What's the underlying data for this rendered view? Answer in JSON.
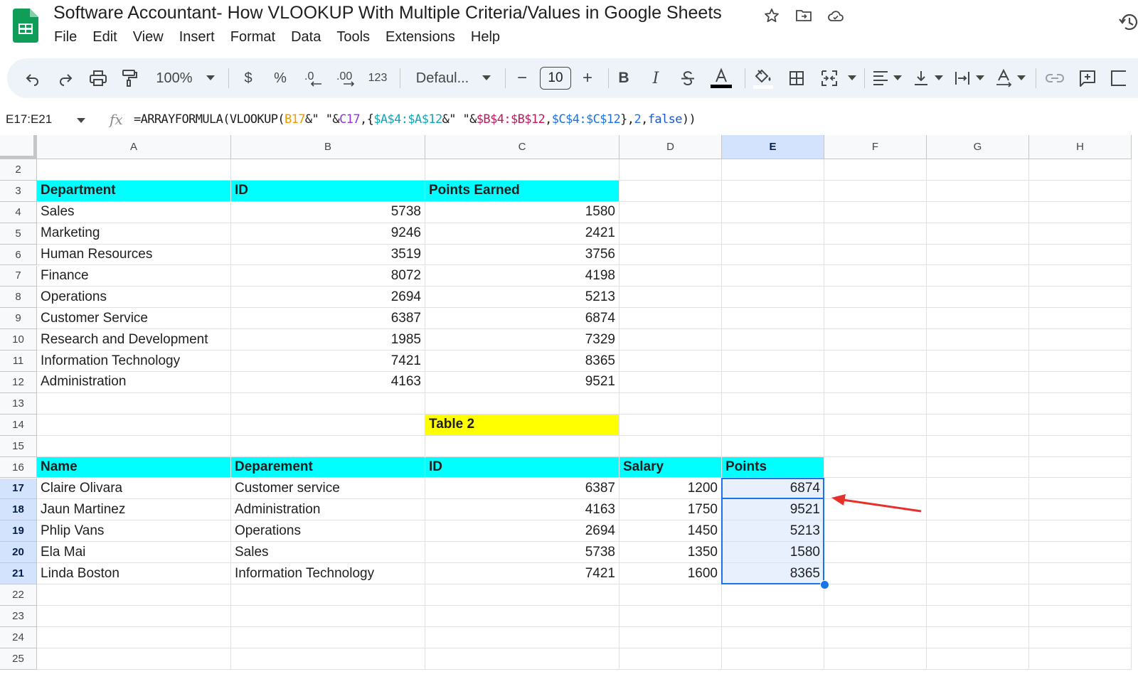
{
  "header": {
    "title": "Software Accountant- How VLOOKUP With Multiple Criteria/Values in Google Sheets",
    "menu": [
      "File",
      "Edit",
      "View",
      "Insert",
      "Format",
      "Data",
      "Tools",
      "Extensions",
      "Help"
    ]
  },
  "toolbar": {
    "zoom": "100%",
    "currency": "$",
    "percent": "%",
    "number_format": "123",
    "font": "Defaul...",
    "font_size": "10",
    "minus": "−",
    "plus": "+",
    "bold": "B",
    "italic": "I"
  },
  "formula_bar": {
    "namebox": "E17:E21",
    "fx": "fx",
    "formula_parts": [
      {
        "text": "=ARRAYFORMULA(VLOOKUP(",
        "color": "#1f1f1f"
      },
      {
        "text": "B17",
        "color": "#f29900"
      },
      {
        "text": "&\" \"&",
        "color": "#1f1f1f"
      },
      {
        "text": "C17",
        "color": "#9334e6"
      },
      {
        "text": ",{",
        "color": "#1f1f1f"
      },
      {
        "text": "$A$4:$A$12",
        "color": "#12a4b8"
      },
      {
        "text": "&\" \"&",
        "color": "#1f1f1f"
      },
      {
        "text": "$B$4:$B$12",
        "color": "#c2185b"
      },
      {
        "text": ",",
        "color": "#1f1f1f"
      },
      {
        "text": "$C$4:$C$12",
        "color": "#1a73e8"
      },
      {
        "text": "},",
        "color": "#1f1f1f"
      },
      {
        "text": "2",
        "color": "#1a73e8"
      },
      {
        "text": ",",
        "color": "#1f1f1f"
      },
      {
        "text": "false",
        "color": "#1a56db"
      },
      {
        "text": "))",
        "color": "#1f1f1f"
      }
    ]
  },
  "sheet": {
    "columns": [
      "A",
      "B",
      "C",
      "D",
      "E",
      "F",
      "G",
      "H"
    ],
    "selected_column": "E",
    "rows": [
      {
        "n": "2",
        "cells": []
      },
      {
        "n": "3",
        "cells": [
          {
            "col": "A",
            "v": "Department",
            "style": "hdr"
          },
          {
            "col": "B",
            "v": "ID",
            "style": "hdr"
          },
          {
            "col": "C",
            "v": "Points Earned",
            "style": "hdr"
          }
        ]
      },
      {
        "n": "4",
        "cells": [
          {
            "col": "A",
            "v": "Sales"
          },
          {
            "col": "B",
            "v": "5738",
            "num": true
          },
          {
            "col": "C",
            "v": "1580",
            "num": true
          }
        ]
      },
      {
        "n": "5",
        "cells": [
          {
            "col": "A",
            "v": "Marketing"
          },
          {
            "col": "B",
            "v": "9246",
            "num": true
          },
          {
            "col": "C",
            "v": "2421",
            "num": true
          }
        ]
      },
      {
        "n": "6",
        "cells": [
          {
            "col": "A",
            "v": "Human Resources"
          },
          {
            "col": "B",
            "v": "3519",
            "num": true
          },
          {
            "col": "C",
            "v": "3756",
            "num": true
          }
        ]
      },
      {
        "n": "7",
        "cells": [
          {
            "col": "A",
            "v": "Finance"
          },
          {
            "col": "B",
            "v": "8072",
            "num": true
          },
          {
            "col": "C",
            "v": "4198",
            "num": true
          }
        ]
      },
      {
        "n": "8",
        "cells": [
          {
            "col": "A",
            "v": "Operations"
          },
          {
            "col": "B",
            "v": "2694",
            "num": true
          },
          {
            "col": "C",
            "v": "5213",
            "num": true
          }
        ]
      },
      {
        "n": "9",
        "cells": [
          {
            "col": "A",
            "v": "Customer Service"
          },
          {
            "col": "B",
            "v": "6387",
            "num": true
          },
          {
            "col": "C",
            "v": "6874",
            "num": true
          }
        ]
      },
      {
        "n": "10",
        "cells": [
          {
            "col": "A",
            "v": "Research and Development"
          },
          {
            "col": "B",
            "v": "1985",
            "num": true
          },
          {
            "col": "C",
            "v": "7329",
            "num": true
          }
        ]
      },
      {
        "n": "11",
        "cells": [
          {
            "col": "A",
            "v": "Information Technology"
          },
          {
            "col": "B",
            "v": "7421",
            "num": true
          },
          {
            "col": "C",
            "v": "8365",
            "num": true
          }
        ]
      },
      {
        "n": "12",
        "cells": [
          {
            "col": "A",
            "v": "Administration"
          },
          {
            "col": "B",
            "v": "4163",
            "num": true
          },
          {
            "col": "C",
            "v": "9521",
            "num": true
          }
        ]
      },
      {
        "n": "13",
        "cells": []
      },
      {
        "n": "14",
        "cells": [
          {
            "col": "C",
            "v": "Table 2",
            "style": "yel"
          }
        ]
      },
      {
        "n": "15",
        "cells": []
      },
      {
        "n": "16",
        "cells": [
          {
            "col": "A",
            "v": "Name",
            "style": "hdr"
          },
          {
            "col": "B",
            "v": "Deparement",
            "style": "hdr"
          },
          {
            "col": "C",
            "v": "ID",
            "style": "hdr"
          },
          {
            "col": "D",
            "v": "Salary",
            "style": "hdr"
          },
          {
            "col": "E",
            "v": "Points",
            "style": "hdr"
          }
        ]
      },
      {
        "n": "17",
        "sel": true,
        "cells": [
          {
            "col": "A",
            "v": "Claire Olivara"
          },
          {
            "col": "B",
            "v": "Customer service"
          },
          {
            "col": "C",
            "v": "6387",
            "num": true
          },
          {
            "col": "D",
            "v": "1200",
            "num": true
          },
          {
            "col": "E",
            "v": "6874",
            "num": true,
            "style": "selr"
          }
        ]
      },
      {
        "n": "18",
        "sel": true,
        "cells": [
          {
            "col": "A",
            "v": "Jaun Martinez"
          },
          {
            "col": "B",
            "v": "Administration"
          },
          {
            "col": "C",
            "v": "4163",
            "num": true
          },
          {
            "col": "D",
            "v": "1750",
            "num": true
          },
          {
            "col": "E",
            "v": "9521",
            "num": true,
            "style": "selr"
          }
        ]
      },
      {
        "n": "19",
        "sel": true,
        "cells": [
          {
            "col": "A",
            "v": "Phlip Vans"
          },
          {
            "col": "B",
            "v": "Operations"
          },
          {
            "col": "C",
            "v": "2694",
            "num": true
          },
          {
            "col": "D",
            "v": "1450",
            "num": true
          },
          {
            "col": "E",
            "v": "5213",
            "num": true,
            "style": "selr"
          }
        ]
      },
      {
        "n": "20",
        "sel": true,
        "cells": [
          {
            "col": "A",
            "v": "Ela Mai"
          },
          {
            "col": "B",
            "v": "Sales"
          },
          {
            "col": "C",
            "v": "5738",
            "num": true
          },
          {
            "col": "D",
            "v": "1350",
            "num": true
          },
          {
            "col": "E",
            "v": "1580",
            "num": true,
            "style": "selr"
          }
        ]
      },
      {
        "n": "21",
        "sel": true,
        "cells": [
          {
            "col": "A",
            "v": "Linda Boston"
          },
          {
            "col": "B",
            "v": "Information Technology"
          },
          {
            "col": "C",
            "v": "7421",
            "num": true
          },
          {
            "col": "D",
            "v": "1600",
            "num": true
          },
          {
            "col": "E",
            "v": "8365",
            "num": true,
            "style": "selr"
          }
        ]
      },
      {
        "n": "22",
        "cells": []
      },
      {
        "n": "23",
        "cells": []
      },
      {
        "n": "24",
        "cells": []
      },
      {
        "n": "25",
        "cells": []
      }
    ]
  },
  "colors": {
    "header_fill": "#00ffff",
    "table2_fill": "#ffff00",
    "selection": "#1a73e8",
    "annotation_arrow": "#e8302a"
  }
}
